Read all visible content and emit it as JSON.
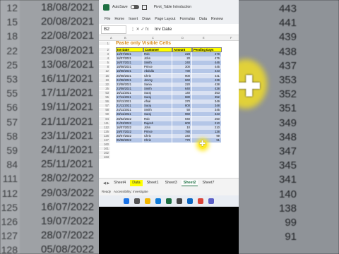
{
  "background": {
    "left_rows": [
      {
        "num": "12",
        "date": "18/08/2021"
      },
      {
        "num": "15",
        "date": "20/08/2021"
      },
      {
        "num": "18",
        "date": "22/08/2021"
      },
      {
        "num": "22",
        "date": "23/08/2021"
      },
      {
        "num": "25",
        "date": "13/08/2021"
      },
      {
        "num": "53",
        "date": "16/11/2021"
      },
      {
        "num": "55",
        "date": "17/11/2021"
      },
      {
        "num": "56",
        "date": "19/11/2021"
      },
      {
        "num": "57",
        "date": "21/11/2021"
      },
      {
        "num": "58",
        "date": "23/11/2021"
      },
      {
        "num": "59",
        "date": "24/11/2021"
      },
      {
        "num": "84",
        "date": "25/11/2021"
      },
      {
        "num": "111",
        "date": "28/02/2022"
      },
      {
        "num": "112",
        "date": "29/03/2022"
      },
      {
        "num": "125",
        "date": "16/07/2022"
      },
      {
        "num": "126",
        "date": "19/07/2022"
      },
      {
        "num": "127",
        "date": "28/07/2022"
      },
      {
        "num": "128",
        "date": "05/08/2022"
      }
    ],
    "right_values": [
      "443",
      "441",
      "439",
      "438",
      "437",
      "353",
      "352",
      "351",
      "349",
      "348",
      "347",
      "345",
      "341",
      "140",
      "138",
      "99",
      "91"
    ]
  },
  "excel": {
    "autosave_label": "AutoSave",
    "document_name": "Pivot_Table Introduction",
    "menu": [
      "File",
      "Home",
      "Insert",
      "Draw",
      "Page Layout",
      "Formulas",
      "Data",
      "Review"
    ],
    "name_box": "B2",
    "formula_icons": "⋮ ✕ ✓ fx",
    "formula_value": "Inv Date",
    "columns": [
      "A",
      "B",
      "C",
      "D",
      "E",
      "F"
    ],
    "sheet_title": "Paste only Visible Cells",
    "headers": [
      "Inv Date",
      "Customer",
      "Amount",
      "Pending Days"
    ],
    "rows": [
      {
        "n": "3",
        "date": "14/07/2021",
        "cust": "Rob",
        "amt": "228",
        "days": "478"
      },
      {
        "n": "4",
        "date": "16/07/2021",
        "cust": "John",
        "amt": "20",
        "days": "476"
      },
      {
        "n": "5",
        "date": "16/07/2021",
        "cust": "Smith",
        "amt": "240",
        "days": "446"
      },
      {
        "n": "8",
        "date": "18/08/2021",
        "cust": "Prince",
        "amt": "300",
        "days": "445"
      },
      {
        "n": "12",
        "date": "18/08/2021",
        "cust": "Abdulla",
        "amt": "730",
        "days": "443"
      },
      {
        "n": "15",
        "date": "20/08/2021",
        "cust": "Chris",
        "amt": "900",
        "days": "441"
      },
      {
        "n": "18",
        "date": "22/08/2021",
        "cust": "Jimmy",
        "amt": "660",
        "days": "439"
      },
      {
        "n": "22",
        "date": "23/08/2021",
        "cust": "Sania",
        "amt": "220",
        "days": "438"
      },
      {
        "n": "25",
        "date": "23/08/2021",
        "cust": "Smith",
        "amt": "640",
        "days": "438"
      },
      {
        "n": "53",
        "date": "16/11/2021",
        "cust": "Suraj",
        "amt": "140",
        "days": "353"
      },
      {
        "n": "55",
        "date": "17/11/2021",
        "cust": "Suraj",
        "amt": "680",
        "days": "352"
      },
      {
        "n": "56",
        "date": "20/11/2021",
        "cust": "Afsal",
        "amt": "370",
        "days": "349"
      },
      {
        "n": "57",
        "date": "21/11/2021",
        "cust": "Suraj",
        "amt": "800",
        "days": "348"
      },
      {
        "n": "58",
        "date": "24/11/2021",
        "cust": "Smith",
        "amt": "50",
        "days": "345"
      },
      {
        "n": "59",
        "date": "28/11/2021",
        "cust": "Suraj",
        "amt": "960",
        "days": "343"
      },
      {
        "n": "84",
        "date": "28/02/2022",
        "cust": "Rob",
        "amt": "940",
        "days": "250"
      },
      {
        "n": "111",
        "date": "21/03/2022",
        "cust": "Rajesh",
        "amt": "600",
        "days": "210"
      },
      {
        "n": "112",
        "date": "16/07/2022",
        "cust": "John",
        "amt": "10",
        "days": "210"
      },
      {
        "n": "125",
        "date": "19/07/2022",
        "cust": "Prince",
        "amt": "780",
        "days": "138"
      },
      {
        "n": "126",
        "date": "28/07/2022",
        "cust": "Chris",
        "amt": "340",
        "days": "99"
      },
      {
        "n": "127",
        "date": "05/08/2022",
        "cust": "Chris",
        "amt": "770",
        "days": "91"
      }
    ],
    "empty_rows": [
      "160",
      "161",
      "162",
      "163"
    ],
    "tab_nav": "◀ ▶",
    "tabs": [
      {
        "label": "Sheet4",
        "state": "normal"
      },
      {
        "label": "Data",
        "state": "highlight"
      },
      {
        "label": "Sheet1",
        "state": "normal"
      },
      {
        "label": "Sheet3",
        "state": "normal"
      },
      {
        "label": "Sheet2",
        "state": "active"
      },
      {
        "label": "Sheet7",
        "state": "normal"
      }
    ],
    "status_ready": "Ready",
    "status_accessibility": "Accessibility: Investigate"
  },
  "colors": {
    "header_yellow": "#ffff00",
    "title_orange": "#d98c1f",
    "band_dark": "#b4c6e7",
    "band_light": "#d9e1f2",
    "excel_green": "#1d6f42"
  },
  "taskbar_icons": [
    "windows-icon",
    "search-icon",
    "file-explorer-icon",
    "edge-icon",
    "excel-icon",
    "store-icon",
    "photos-icon",
    "chrome-icon",
    "teams-icon"
  ]
}
